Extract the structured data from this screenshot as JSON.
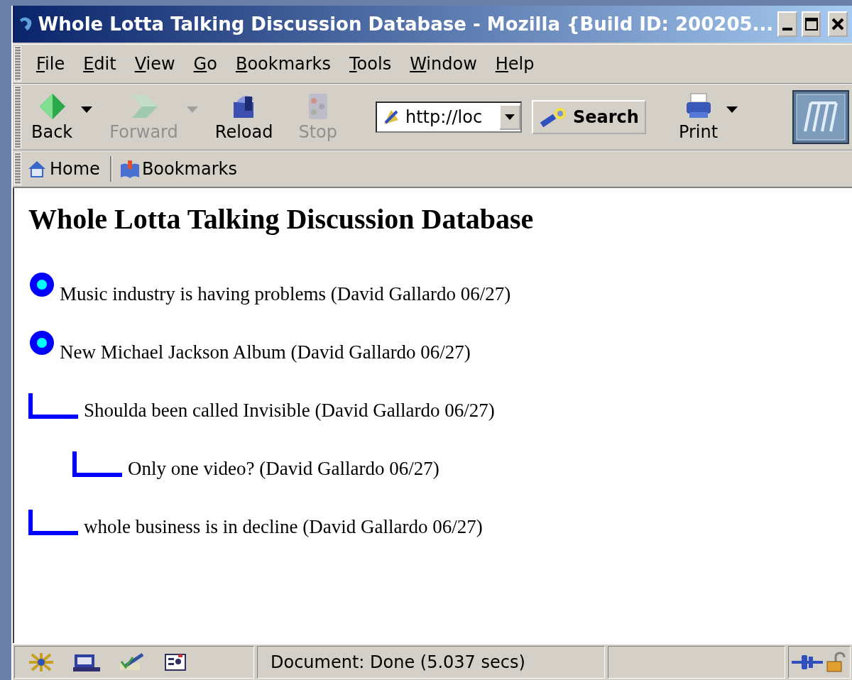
{
  "window": {
    "title": "Whole Lotta Talking Discussion Database - Mozilla {Build ID: 200205..."
  },
  "menu": [
    "File",
    "Edit",
    "View",
    "Go",
    "Bookmarks",
    "Tools",
    "Window",
    "Help"
  ],
  "toolbar": [
    {
      "kind": "back",
      "label": "Back",
      "disabled": false,
      "dropdown": true
    },
    {
      "kind": "forward",
      "label": "Forward",
      "disabled": true,
      "dropdown": true
    },
    {
      "kind": "reload",
      "label": "Reload",
      "disabled": false,
      "dropdown": false
    },
    {
      "kind": "stop",
      "label": "Stop",
      "disabled": true,
      "dropdown": false
    }
  ],
  "address": {
    "value": "http://loc"
  },
  "search_button": "Search",
  "print": {
    "label": "Print",
    "dropdown": true
  },
  "personal_bar": [
    {
      "kind": "home",
      "label": "Home"
    },
    {
      "kind": "bookmarks",
      "label": "Bookmarks"
    }
  ],
  "page": {
    "heading": "Whole Lotta Talking Discussion Database",
    "threads": [
      {
        "text": "Music industry is having problems (David Gallardo 06/27)"
      },
      {
        "text": "New Michael Jackson Album (David Gallardo 06/27)",
        "children": [
          {
            "text": "Shoulda been called Invisible (David Gallardo 06/27)",
            "children": [
              {
                "text": "Only one video? (David Gallardo 06/27)"
              }
            ]
          },
          {
            "text": "whole business is in decline (David Gallardo 06/27)"
          }
        ]
      }
    ]
  },
  "status_bar": {
    "text": "Document: Done (5.037 secs)"
  }
}
